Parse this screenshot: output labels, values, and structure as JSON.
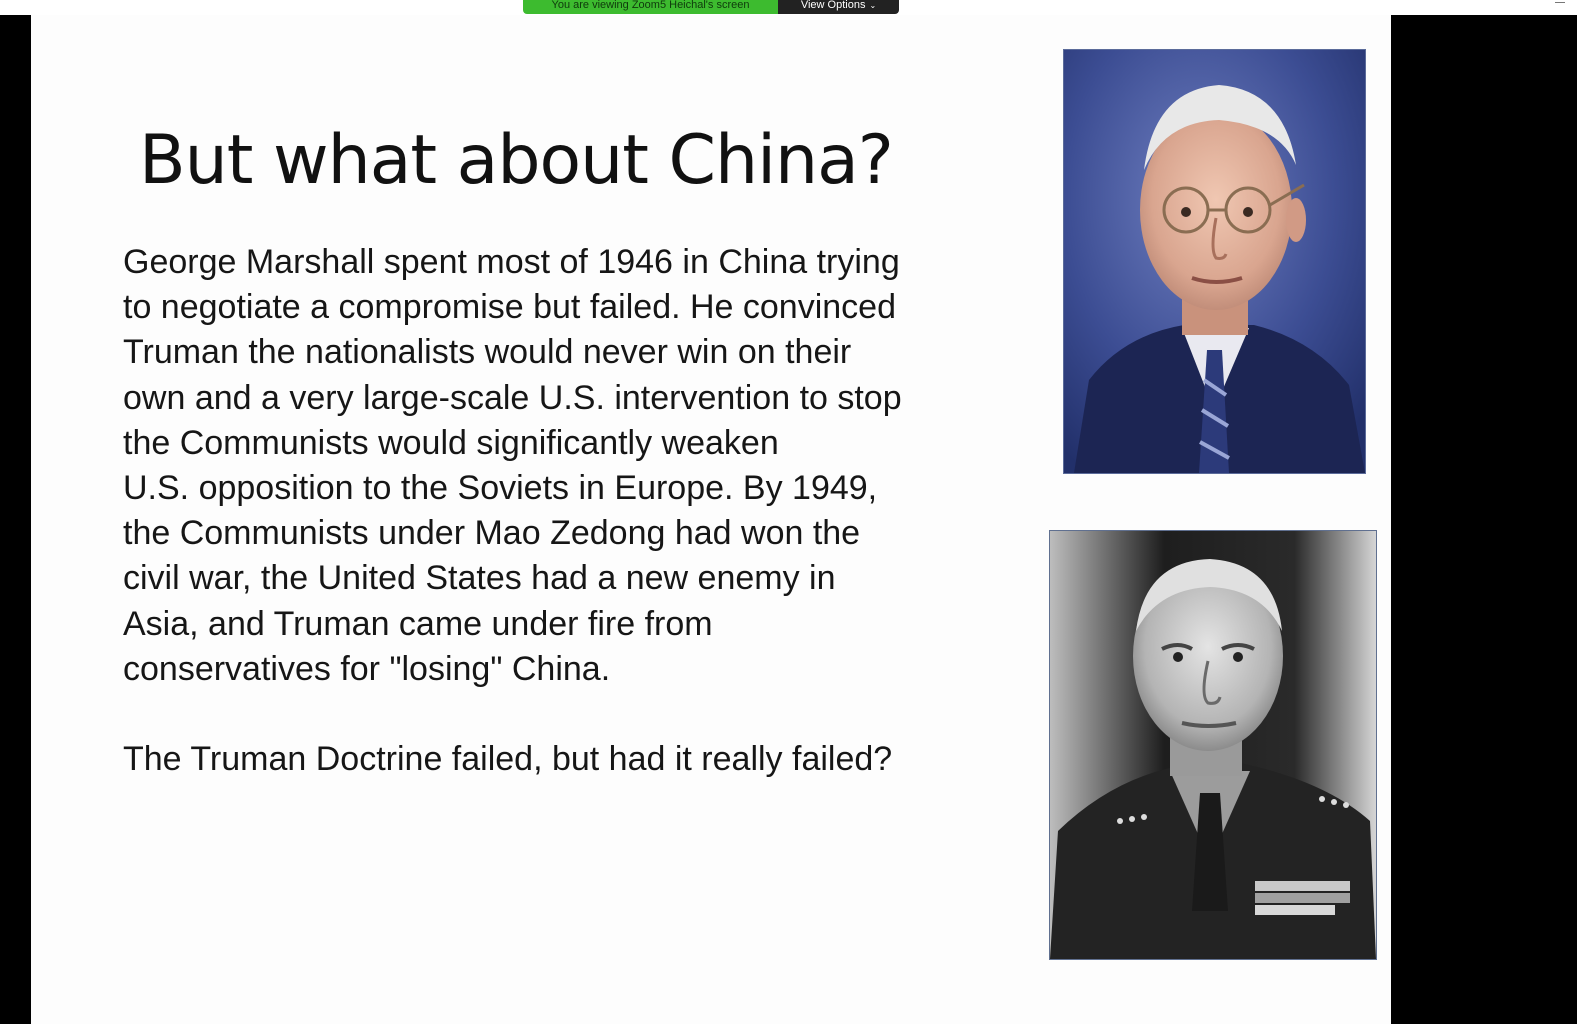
{
  "share_banner": {
    "status_text": "You are viewing Zoom5 Heichal's screen",
    "view_options_label": "View Options"
  },
  "slide": {
    "title": "But what about China?",
    "body_lines": [
      "George Marshall spent most of 1946 in China trying",
      "to negotiate a compromise but failed. He convinced",
      "Truman the nationalists would never win on their",
      "own and a very large-scale U.S. intervention to stop",
      "the Communists would significantly weaken",
      "U.S. opposition to the Soviets in Europe. By 1949,",
      "the Communists under Mao Zedong had won the",
      "civil war, the United States had a new enemy in",
      "Asia, and Truman came under fire from",
      "conservatives for \"losing\" China."
    ],
    "question": "The Truman Doctrine failed, but had it really failed?"
  },
  "icons": {
    "dropdown": "chevron-down-icon",
    "window": "minimize-icon"
  },
  "colors": {
    "banner_green": "#3dbb2f",
    "banner_dark": "#222222",
    "letterbox": "#000000",
    "slide_bg": "#fdfdfd"
  }
}
